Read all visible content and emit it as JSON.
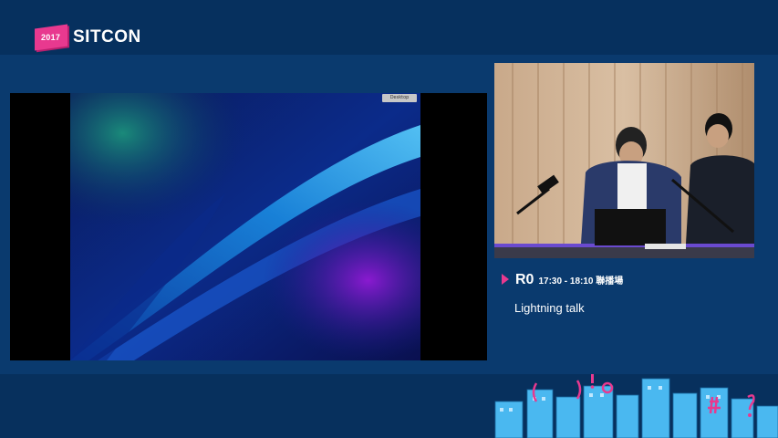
{
  "logo": {
    "year": "2017",
    "name": "SITCON"
  },
  "screen_share": {
    "desktop_button_label": "Desktop"
  },
  "session": {
    "room": "R0",
    "time": "17:30 - 18:10 聯播場",
    "title": "Lightning talk"
  },
  "colors": {
    "background": "#052a55",
    "accent": "#e8398f",
    "panel": "#0a3a6e"
  },
  "icons": [
    "play-arrow-icon"
  ]
}
